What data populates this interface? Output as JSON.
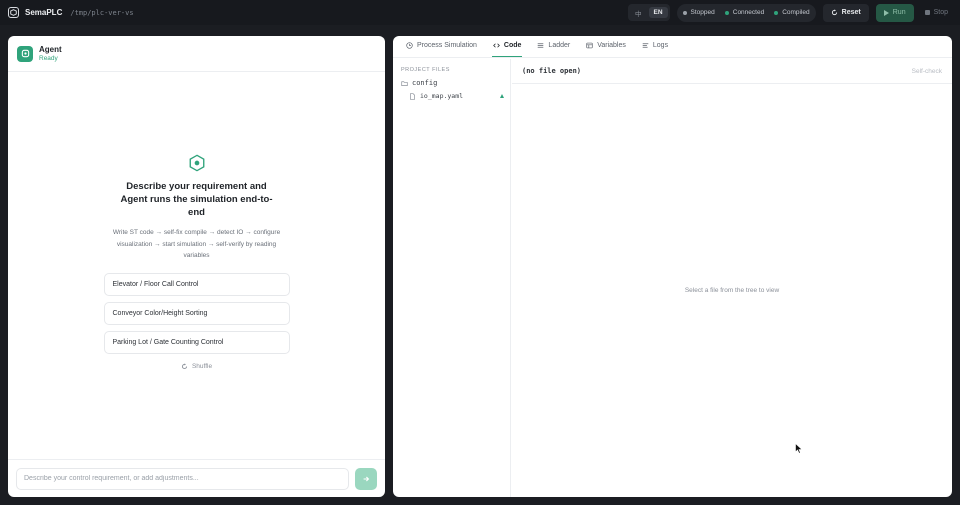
{
  "topbar": {
    "app_title": "SemaPLC",
    "path": "/tmp/plc-ver-vs",
    "lang_options": [
      "中",
      "EN"
    ],
    "lang_active": "EN",
    "statuses": [
      {
        "label": "Stopped",
        "color": "#9aa0a8"
      },
      {
        "label": "Connected",
        "color": "#2fa37b"
      },
      {
        "label": "Compiled",
        "color": "#2fa37b"
      }
    ],
    "reset_label": "Reset",
    "run_label": "Run",
    "stop_label": "Stop"
  },
  "agent": {
    "name": "Agent",
    "status": "Ready",
    "hero_title": "Describe your requirement and Agent runs the simulation end-to-end",
    "hero_desc": "Write ST code → self-fix compile → detect IO → configure visualization → start simulation → self-verify by reading variables",
    "suggestions": [
      "Elevator / Floor Call Control",
      "Conveyor Color/Height Sorting",
      "Parking Lot / Gate Counting Control"
    ],
    "shuffle_label": "Shuffle",
    "input_placeholder": "Describe your control requirement, or add adjustments..."
  },
  "workspace": {
    "tabs": [
      {
        "label": "Process Simulation",
        "icon": "clock-icon"
      },
      {
        "label": "Code",
        "icon": "code-icon"
      },
      {
        "label": "Ladder",
        "icon": "list-icon"
      },
      {
        "label": "Variables",
        "icon": "table-icon"
      },
      {
        "label": "Logs",
        "icon": "lines-icon"
      }
    ],
    "active_tab": "Code",
    "files_heading": "PROJECT FILES",
    "folder_name": "config",
    "file_name": "io_map.yaml",
    "no_file_label": "(no file open)",
    "self_check_label": "Self-check",
    "empty_message": "Select a file from the tree to view"
  },
  "colors": {
    "accent": "#2fa37b",
    "topbar_bg": "#17191e",
    "panel_bg": "#ffffff"
  }
}
